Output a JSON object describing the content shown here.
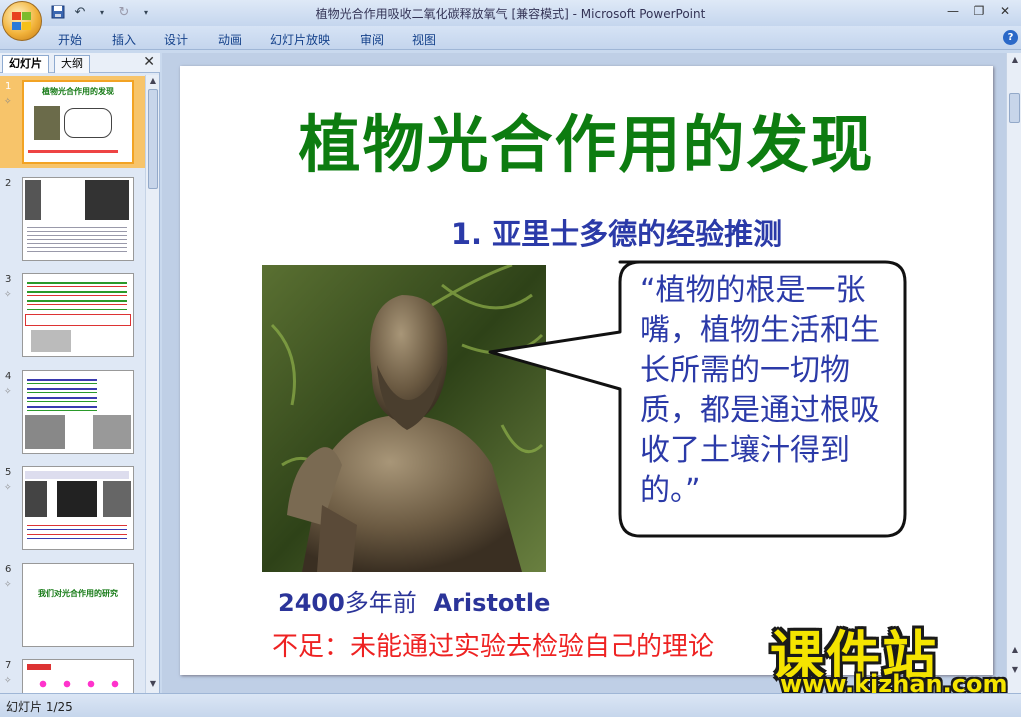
{
  "window": {
    "title": "植物光合作用吸收二氧化碳释放氧气 [兼容模式] - Microsoft PowerPoint"
  },
  "ribbon": {
    "tabs": [
      "开始",
      "插入",
      "设计",
      "动画",
      "幻灯片放映",
      "审阅",
      "视图"
    ]
  },
  "panel": {
    "tab_slides": "幻灯片",
    "tab_outline": "大纲",
    "thumbnails": [
      {
        "num": "1",
        "title": "植物光合作用的发现"
      },
      {
        "num": "2",
        "title": ""
      },
      {
        "num": "3",
        "title": ""
      },
      {
        "num": "4",
        "title": ""
      },
      {
        "num": "5",
        "title": ""
      },
      {
        "num": "6",
        "title": "我们对光合作用的研究"
      },
      {
        "num": "7",
        "title": ""
      }
    ]
  },
  "slide": {
    "title": "植物光合作用的发现",
    "subtitle": "1. 亚里士多德的经验推测",
    "quote": "“植物的根是一张嘴，植物生活和生长所需的一切物质，都是通过根吸收了土壤汁得到的。”",
    "caption_year": "2400",
    "caption_mid": "多年前",
    "caption_name": "Aristotle",
    "note": "不足：未能通过实验去检验自己的理论"
  },
  "status": {
    "text": "幻灯片 1/25"
  },
  "watermark": {
    "main": "课件站",
    "url": "www.kjzhan.com"
  },
  "colors": {
    "title_green": "#0d7c10",
    "subtitle_blue": "#2b3aa8",
    "note_red": "#e22222",
    "watermark_yellow": "#f5e400"
  }
}
